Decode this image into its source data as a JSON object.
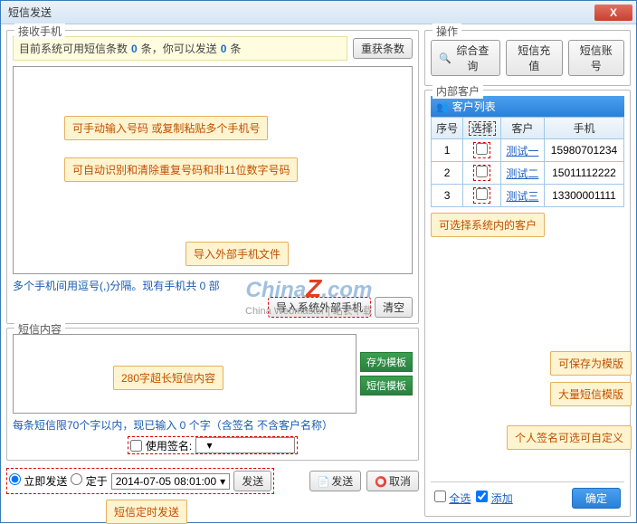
{
  "window": {
    "title": "短信发送",
    "close": "X"
  },
  "recv": {
    "legend": "接收手机",
    "info_pre": "目前系统可用短信条数",
    "info_mid": "条，你可以发送",
    "info_unit2": "条",
    "count1": "0",
    "count2": "0",
    "btn_recount": "重获条数",
    "note1": "可手动输入号码 或复制粘贴多个手机号",
    "note2": "可自动识别和清除重复号码和非11位数字号码",
    "note3": "导入外部手机文件",
    "hint": "多个手机间用逗号(,)分隔。现有手机共 0 部",
    "btn_import": "导入系统外部手机",
    "btn_clear": "清空"
  },
  "sms": {
    "legend": "短信内容",
    "placeholder_note": "280字超长短信内容",
    "btn_save_tpl": "存为模板",
    "btn_tpl": "短信模板",
    "hint": "每条短信限70个字以内，现已输入 0 个字（含签名 不含客户名称）",
    "use_sig_label": "使用签名:",
    "side_note1": "可保存为模版",
    "side_note2": "大量短信模版",
    "side_note3": "个人签名可选可自定义"
  },
  "send": {
    "radio_now": "立即发送",
    "radio_at": "定于",
    "datetime": "2014-07-05 08:01:00",
    "btn_go": "发送",
    "btn_send": "发送",
    "btn_cancel": "取消",
    "note": "短信定时发送"
  },
  "ops": {
    "legend": "操作",
    "btn_query": "综合查询",
    "btn_recharge": "短信充值",
    "btn_account": "短信账号"
  },
  "clients": {
    "legend": "内部客户",
    "header": "客户列表",
    "cols": {
      "seq": "序号",
      "sel": "选择",
      "cust": "客户",
      "phone": "手机"
    },
    "rows": [
      {
        "seq": "1",
        "name": "测试一",
        "phone": "15980701234"
      },
      {
        "seq": "2",
        "name": "测试二",
        "phone": "15011112222"
      },
      {
        "seq": "3",
        "name": "测试三",
        "phone": "13300001111"
      }
    ],
    "note": "可选择系统内的客户",
    "select_all": "全选",
    "add": "添加",
    "confirm": "确定"
  },
  "watermark": {
    "main_a": "China",
    "main_b": "Z",
    "main_c": ".com",
    "sub": "China Webmaster | 站长下载"
  }
}
